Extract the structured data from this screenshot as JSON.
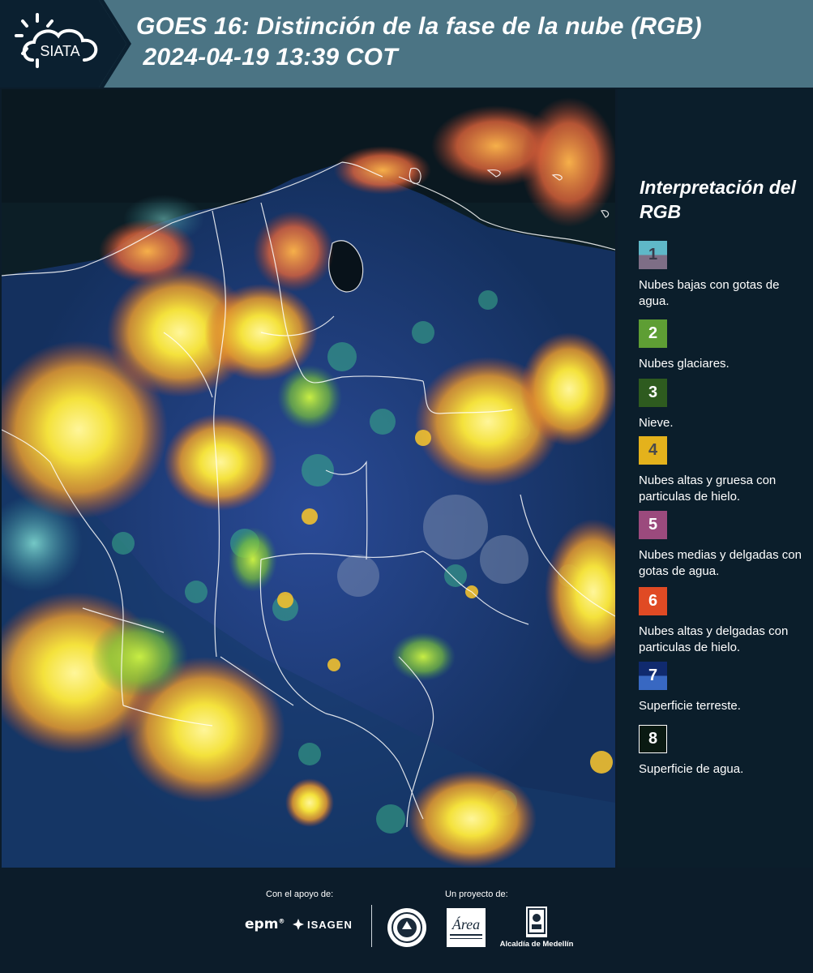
{
  "header": {
    "logo_text": "SIATA",
    "title_line1": "GOES 16: Distinción de la fase de la nube (RGB)",
    "title_line2": " 2024-04-19 13:39 COT"
  },
  "legend": {
    "title": "Interpretación del RGB",
    "items": [
      {
        "number": "1",
        "label": "Nubes bajas con gotas de agua.",
        "color_top": "#5fb8c8",
        "color_bottom": "#7e6e86"
      },
      {
        "number": "2",
        "label": "Nubes glaciares.",
        "color": "#5e9e34"
      },
      {
        "number": "3",
        "label": "Nieve.",
        "color": "#2e5b1f"
      },
      {
        "number": "4",
        "label": "Nubes altas y gruesa con particulas de hielo.",
        "color": "#e4b21c"
      },
      {
        "number": "5",
        "label": "Nubes medias y delgadas con gotas de agua.",
        "color": "#9b4a7d"
      },
      {
        "number": "6",
        "label": "Nubes altas y delgadas con particulas de hielo.",
        "color": "#e04a24"
      },
      {
        "number": "7",
        "label": "Superficie terreste.",
        "color_top": "#102a6e",
        "color_bottom": "#3868c2"
      },
      {
        "number": "8",
        "label": "Superficie de agua.",
        "color": "#0a1a12",
        "border": "#ffffff"
      }
    ]
  },
  "footer": {
    "support_label": "Con el apoyo de:",
    "project_label": "Un proyecto de:",
    "sponsor1": "epm",
    "sponsor2": "ISAGEN",
    "partner1": "Área Metropolitana",
    "partner2": "Alcaldía de Medellín"
  },
  "colors": {
    "header_band": "#4b7484",
    "dark_navy": "#0b2030",
    "cloud_yellow": "#f2e03c",
    "cloud_orange": "#e8743a",
    "land_blue": "#1a3a78",
    "ocean": "#0a1a24"
  }
}
